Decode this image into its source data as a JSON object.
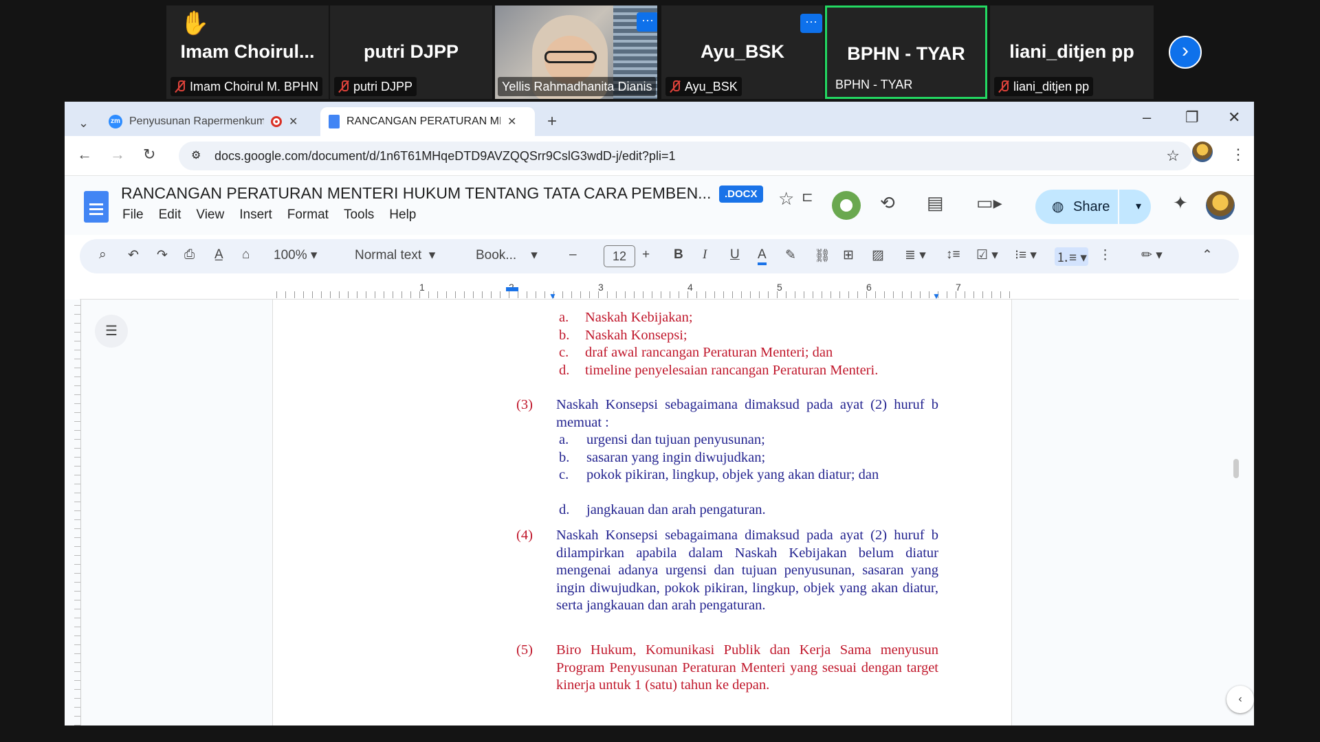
{
  "participants": [
    {
      "name": "Imam  Choirul...",
      "label": "Imam Choirul M. BPHN",
      "muted": true,
      "raised_hand": true
    },
    {
      "name": "putri DJPP",
      "label": "putri DJPP",
      "muted": true
    },
    {
      "name": "",
      "label": "Yellis Rahmadhanita Dianis",
      "video": true
    },
    {
      "name": "Ayu_BSK",
      "label": "Ayu_BSK",
      "muted": true
    },
    {
      "name": "BPHN - TYAR",
      "label": "BPHN - TYAR",
      "active_speaker": true
    },
    {
      "name": "liani_ditjen pp",
      "label": "liani_ditjen pp",
      "muted": true
    }
  ],
  "tabs": [
    {
      "title": "Penyusunan Rapermenkum",
      "icon": "zm"
    },
    {
      "title": "RANCANGAN PERATURAN MEN",
      "icon": "docs"
    }
  ],
  "url": "docs.google.com/document/d/1n6T61MHqeDTD9AVZQQSrr9CslG3wdD-j/edit?pli=1",
  "doc": {
    "title": "RANCANGAN PERATURAN MENTERI HUKUM TENTANG TATA CARA PEMBEN...",
    "badge": ".DOCX",
    "menu": [
      "File",
      "Edit",
      "View",
      "Insert",
      "Format",
      "Tools",
      "Help"
    ],
    "share": "Share"
  },
  "toolbar": {
    "zoom": "100%",
    "style": "Normal text",
    "font": "Book...",
    "size": "12"
  },
  "ruler_numbers": [
    "1",
    "2",
    "3",
    "4",
    "5",
    "6",
    "7"
  ],
  "colors": {
    "red_text": "#c0172b",
    "blue_text": "#23238f",
    "accent": "#1a73e8"
  },
  "content": {
    "list2": [
      {
        "m": "a.",
        "t": "Naskah Kebijakan;"
      },
      {
        "m": "b.",
        "t": "Naskah Konsepsi;"
      },
      {
        "m": "c.",
        "t": "draf awal rancangan Peraturan Menteri; dan"
      },
      {
        "m": "d.",
        "t": "timeline penyelesaian rancangan Peraturan Menteri."
      }
    ],
    "p3_num": "(3)",
    "p3": "Naskah Konsepsi sebagaimana dimaksud pada ayat (2) huruf b memuat :",
    "list3": [
      {
        "m": "a.",
        "t": "urgensi dan tujuan penyusunan;"
      },
      {
        "m": "b.",
        "t": "sasaran yang ingin diwujudkan;"
      },
      {
        "m": "c.",
        "t": "pokok pikiran, lingkup, objek yang akan diatur; dan"
      },
      {
        "m": "d.",
        "t": "jangkauan dan arah pengaturan."
      }
    ],
    "p4_num": "(4)",
    "p4": "Naskah Konsepsi sebagaimana dimaksud pada ayat (2) huruf b dilampirkan apabila dalam Naskah Kebijakan belum diatur mengenai adanya urgensi dan tujuan penyusunan, sasaran yang ingin diwujudkan, pokok pikiran, lingkup, objek yang akan diatur, serta jangkauan dan arah pengaturan.",
    "p5_num": "(5)",
    "p5": "Biro Hukum, Komunikasi Publik dan Kerja Sama menyusun Program Penyusunan Peraturan Menteri yang sesuai dengan target kinerja untuk 1 (satu) tahun ke depan."
  }
}
